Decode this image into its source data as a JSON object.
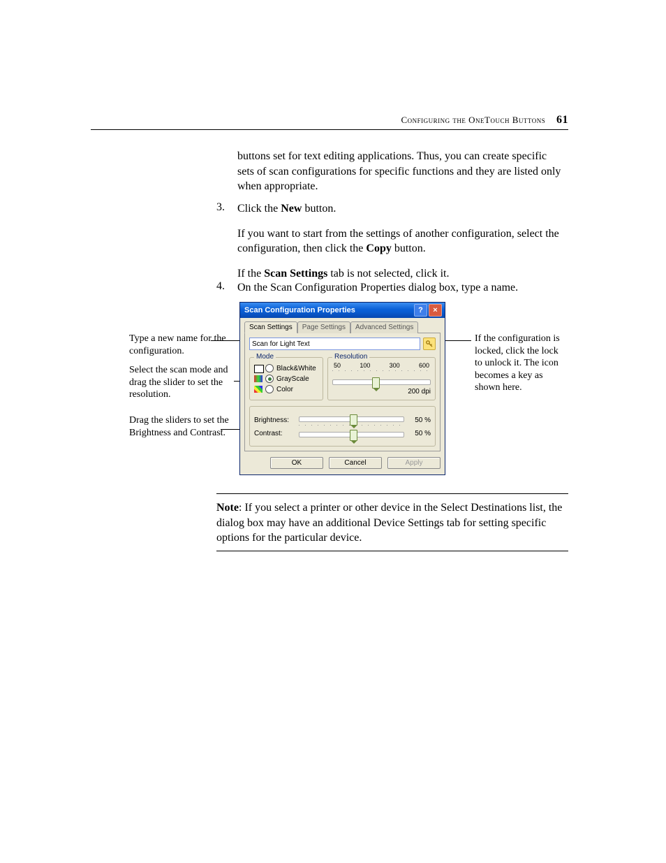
{
  "header": {
    "text": "Configuring the OneTouch Buttons",
    "page": "61"
  },
  "para1": "buttons set for text editing applications. Thus, you can create specific sets of scan configurations for specific functions and they are listed only when appropriate.",
  "step3": {
    "num": "3.",
    "line1a": "Click the ",
    "line1b": "New",
    "line1c": " button.",
    "p2a": "If you want to start from the settings of another configuration, select the configuration, then click the ",
    "p2b": "Copy",
    "p2c": " button.",
    "p3a": "If the ",
    "p3b": "Scan Settings",
    "p3c": " tab is not selected, click it."
  },
  "step4": {
    "num": "4.",
    "text": "On the Scan Configuration Properties dialog box, type a name."
  },
  "callouts": {
    "left1": "Type a new name for the configuration.",
    "left2": "Select the scan mode and drag the slider to set the resolution.",
    "left3": "Drag the sliders to set the Brightness and Contrast.",
    "right1": "If the configuration is locked, click the lock to unlock it. The icon becomes a key as shown here."
  },
  "dialog": {
    "title": "Scan Configuration Properties",
    "tabs": {
      "t1": "Scan Settings",
      "t2": "Page Settings",
      "t3": "Advanced Settings"
    },
    "name_value": "Scan for Light Text",
    "mode": {
      "legend": "Mode",
      "bw": "Black&White",
      "gs": "GrayScale",
      "cl": "Color"
    },
    "res": {
      "legend": "Resolution",
      "l50": "50",
      "l100": "100",
      "l300": "300",
      "l600": "600",
      "val": "200 dpi"
    },
    "bright": {
      "label": "Brightness:",
      "val": "50 %"
    },
    "contrast": {
      "label": "Contrast:",
      "val": "50 %"
    },
    "buttons": {
      "ok": "OK",
      "cancel": "Cancel",
      "apply": "Apply"
    }
  },
  "note": {
    "lead": "Note",
    "sep": ":  ",
    "text": "If you select a printer or other device in the Select Destinations list, the dialog box may have an additional Device Settings tab for setting specific options for the particular device."
  }
}
